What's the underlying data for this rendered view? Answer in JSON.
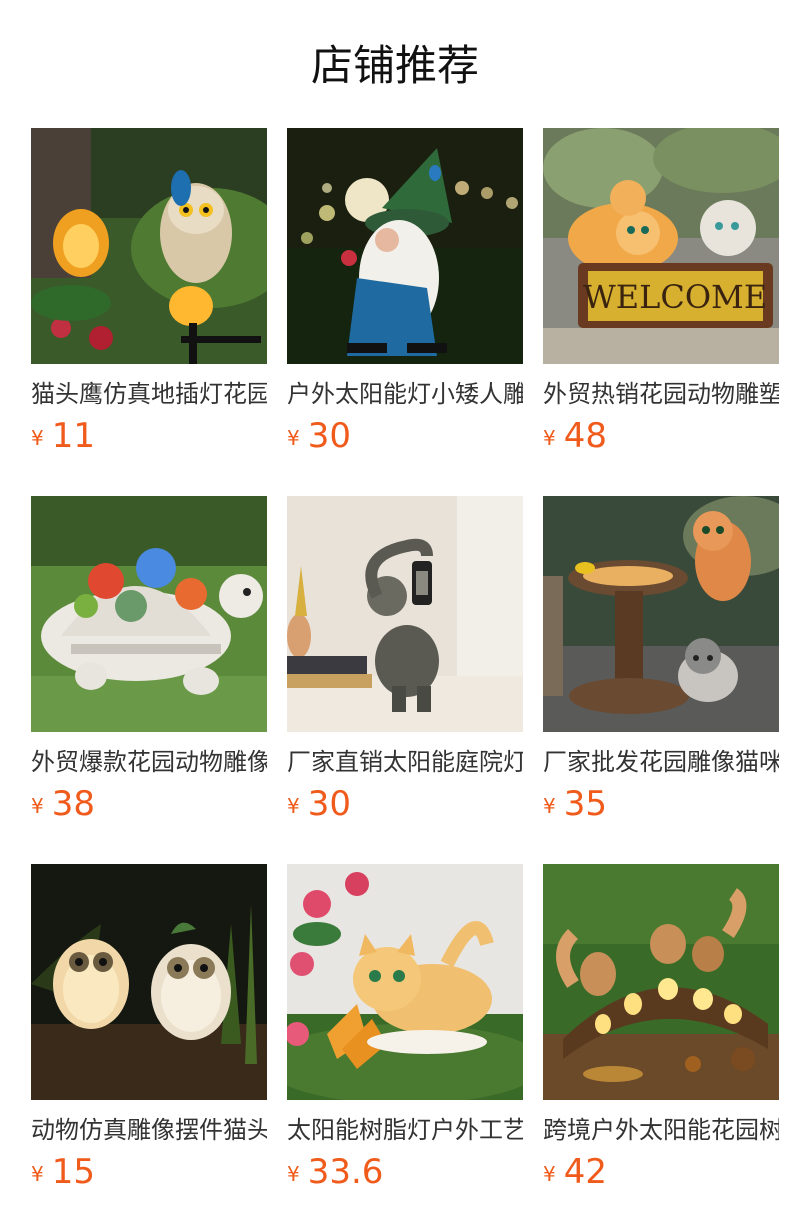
{
  "header": {
    "title": "店铺推荐"
  },
  "currency_symbol": "¥",
  "products": [
    {
      "name": "猫头鹰仿真地插灯花园",
      "price": "11",
      "image": "owl-solar-stake-photo"
    },
    {
      "name": "户外太阳能灯小矮人雕",
      "price": "30",
      "image": "gnome-solar-light-photo"
    },
    {
      "name": "外贸热销花园动物雕塑",
      "price": "48",
      "image": "cats-welcome-sign-photo"
    },
    {
      "name": "外贸爆款花园动物雕像",
      "price": "38",
      "image": "succulent-turtle-photo"
    },
    {
      "name": "厂家直销太阳能庭院灯",
      "price": "30",
      "image": "elephant-lantern-photo"
    },
    {
      "name": "厂家批发花园雕像猫咪",
      "price": "35",
      "image": "cats-birdbath-photo"
    },
    {
      "name": "动物仿真雕像摆件猫头",
      "price": "15",
      "image": "glowing-owls-photo"
    },
    {
      "name": "太阳能树脂灯户外工艺",
      "price": "33.6",
      "image": "cat-butterfly-photo"
    },
    {
      "name": "跨境户外太阳能花园树",
      "price": "42",
      "image": "squirrels-log-photo"
    }
  ]
}
